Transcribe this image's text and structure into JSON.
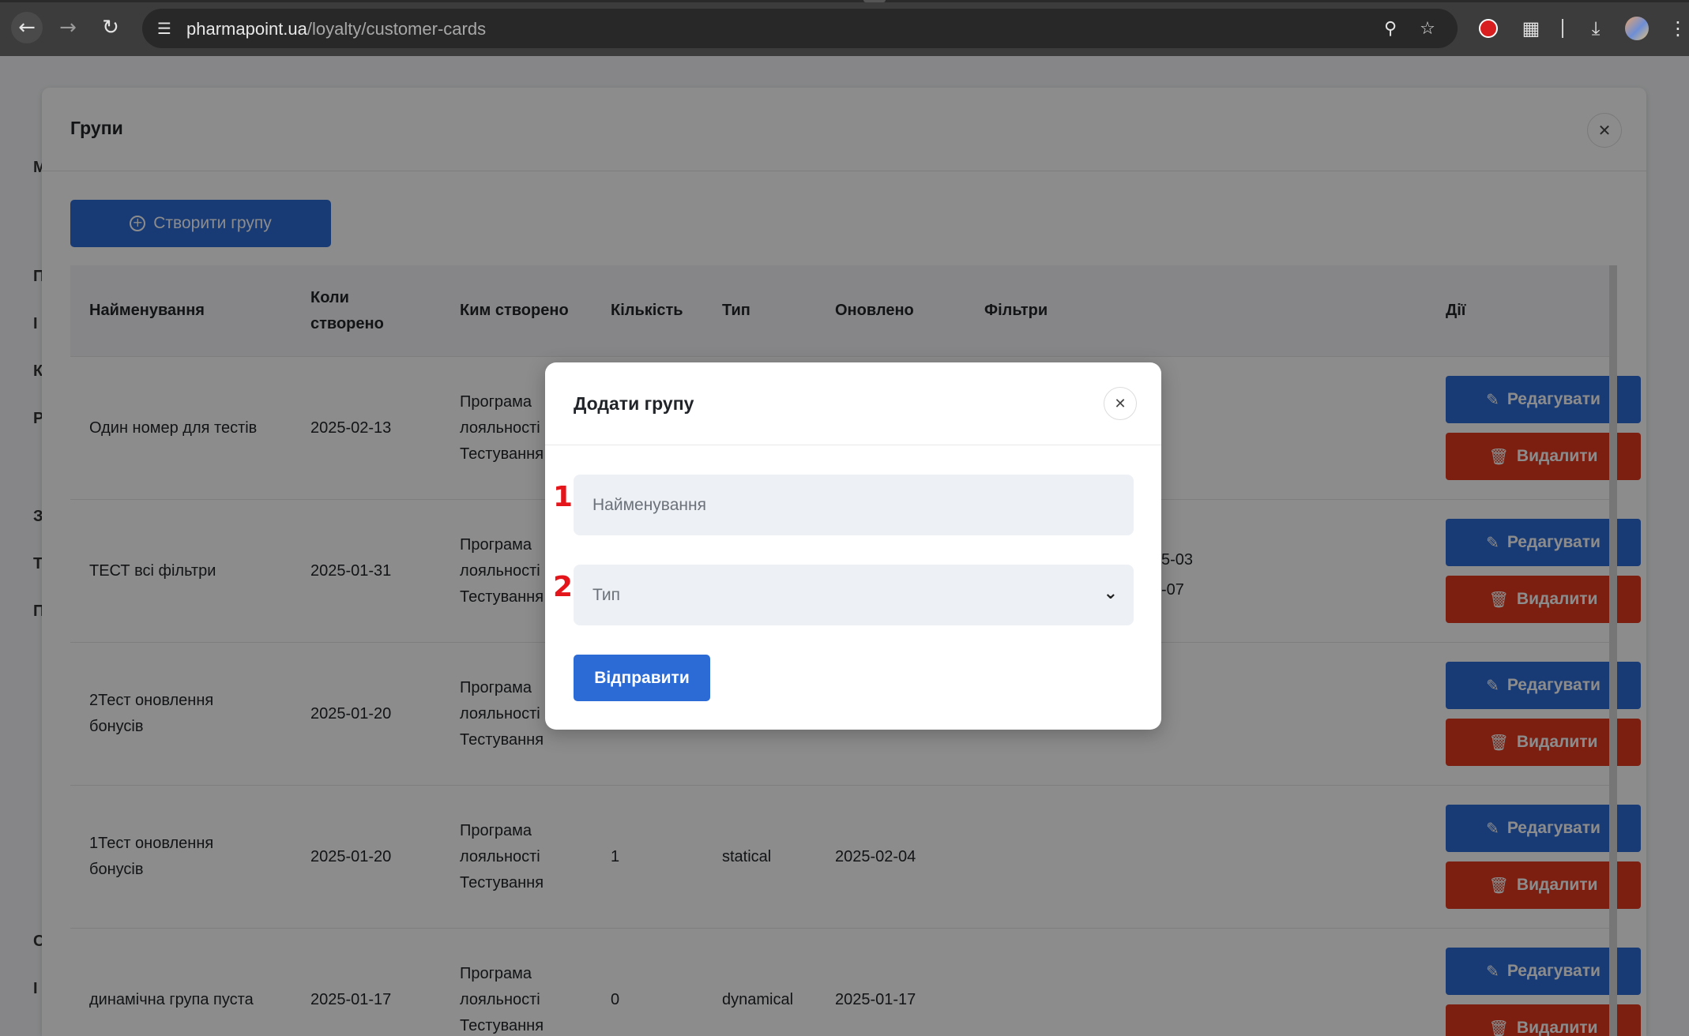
{
  "browser": {
    "url_domain": "pharmapoint.ua",
    "url_path": "/loyalty/customer-cards"
  },
  "sidebar_letters": [
    "M",
    "П",
    "I",
    "К",
    "Р",
    "З",
    "Т",
    "П",
    "С",
    "I"
  ],
  "groups_modal": {
    "title": "Групи",
    "create_button": "Створити групу",
    "columns": [
      "Найменування",
      "Коли створено",
      "Ким створено",
      "Кількість",
      "Тип",
      "Оновлено",
      "Фільтри",
      "Дії"
    ],
    "rows": [
      {
        "name": "Один номер для тестів",
        "created": "2025-02-13",
        "created_by": "Програма лояльності Тестування",
        "count": "",
        "type": "",
        "updated": "",
        "filters": ""
      },
      {
        "name": "ТЕСТ всі фільтри",
        "created": "2025-01-31",
        "created_by": "Програма лояльності Тестування",
        "count": "",
        "type": "",
        "updated": "",
        "filters": "5-03\n-07"
      },
      {
        "name": "2Тест оновлення бонусів",
        "created": "2025-01-20",
        "created_by": "Програма лояльності Тестування",
        "count": "",
        "type": "",
        "updated": "",
        "filters": ""
      },
      {
        "name": "1Тест оновлення бонусів",
        "created": "2025-01-20",
        "created_by": "Програма лояльності Тестування",
        "count": "1",
        "type": "statical",
        "updated": "2025-02-04",
        "filters": ""
      },
      {
        "name": "динамічна група пуста",
        "created": "2025-01-17",
        "created_by": "Програма лояльності Тестування",
        "count": "0",
        "type": "dynamical",
        "updated": "2025-01-17",
        "filters": ""
      }
    ],
    "edit_label": "Редагувати",
    "delete_label": "Видалити"
  },
  "dialog": {
    "title": "Додати групу",
    "name_placeholder": "Найменування",
    "type_placeholder": "Тип",
    "submit_label": "Відправити",
    "badge_1": "1",
    "badge_2": "2"
  },
  "colors": {
    "primary": "#2c6bd6",
    "danger": "#e23a1f",
    "badge": "#e5161b"
  }
}
